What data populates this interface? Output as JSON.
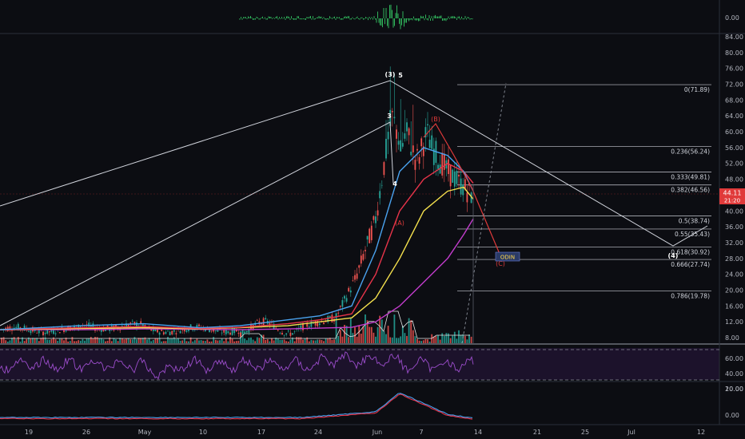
{
  "chart_data": [
    {
      "type": "line",
      "panel": "top-indicator",
      "y_ticks": [
        "0.00"
      ],
      "color": "#2fb25a"
    },
    {
      "type": "candlestick",
      "panel": "main-price",
      "y_ticks": [
        "84.00",
        "80.00",
        "76.00",
        "72.00",
        "68.00",
        "64.00",
        "60.00",
        "56.00",
        "52.00",
        "48.00",
        "44.00",
        "40.00",
        "36.00",
        "32.00",
        "28.00",
        "24.00",
        "20.00",
        "16.00",
        "12.00",
        "8.00"
      ],
      "ylim": [
        4,
        86
      ],
      "x_ticks": [
        "19",
        "26",
        "May",
        "10",
        "17",
        "24",
        "Jun",
        "7",
        "14",
        "21",
        "25",
        "Jul",
        "12"
      ],
      "last_price": "44.11",
      "countdown": "21:20",
      "fib_levels": [
        {
          "label": "0(71.89)",
          "value": 71.89
        },
        {
          "label": "0.236(56.24)",
          "value": 56.24
        },
        {
          "label": "0.333(49.81)",
          "value": 49.81
        },
        {
          "label": "0.382(46.56)",
          "value": 46.56
        },
        {
          "label": "0.5(38.74)",
          "value": 38.74
        },
        {
          "label": "0.55(35.43)",
          "value": 35.43
        },
        {
          "label": "0.618(30.92)",
          "value": 30.92
        },
        {
          "label": "0.666(27.74)",
          "value": 27.74
        },
        {
          "label": "0.786(19.78)",
          "value": 19.78
        }
      ],
      "wave_labels": [
        {
          "text": "(3)",
          "style": "white"
        },
        {
          "text": "5",
          "style": "white"
        },
        {
          "text": "3",
          "style": "white"
        },
        {
          "text": "4",
          "style": "white"
        },
        {
          "text": "(4)",
          "style": "white"
        },
        {
          "text": "(B)",
          "style": "red"
        },
        {
          "text": "(A)",
          "style": "red"
        },
        {
          "text": "(C)",
          "style": "red"
        }
      ],
      "ticker_label": "ODIN",
      "series": [
        {
          "color": "#c23ccc",
          "values": [
            10,
            10,
            10.2,
            10.1,
            10,
            10.2,
            10.4,
            10.6,
            12,
            16,
            22,
            28,
            34,
            38
          ]
        },
        {
          "color": "#f4e04d",
          "values": [
            10,
            10.3,
            10.5,
            10.2,
            10.5,
            11,
            12,
            13,
            18,
            28,
            40,
            45,
            46,
            43
          ]
        },
        {
          "color": "#e8344a",
          "values": [
            10,
            10.5,
            10.8,
            10.3,
            10.6,
            11.5,
            12.5,
            14,
            24,
            40,
            48,
            52,
            50,
            47
          ]
        },
        {
          "color": "#4aa3f0",
          "values": [
            10,
            11,
            11.5,
            10.5,
            11,
            12.5,
            13.5,
            16,
            30,
            50,
            56,
            54,
            50,
            45
          ]
        }
      ],
      "volume_color_up": "#26a69a",
      "volume_color_down": "#ef5350"
    },
    {
      "type": "line",
      "panel": "rsi",
      "y_ticks": [
        "60.00",
        "40.00",
        "20.00"
      ],
      "color": "#9c4dcc"
    },
    {
      "type": "line",
      "panel": "bottom-indicator",
      "y_ticks": [
        "10.00",
        "0.00"
      ],
      "series": [
        {
          "color": "#4aa3f0"
        },
        {
          "color": "#e8344a"
        }
      ]
    }
  ]
}
